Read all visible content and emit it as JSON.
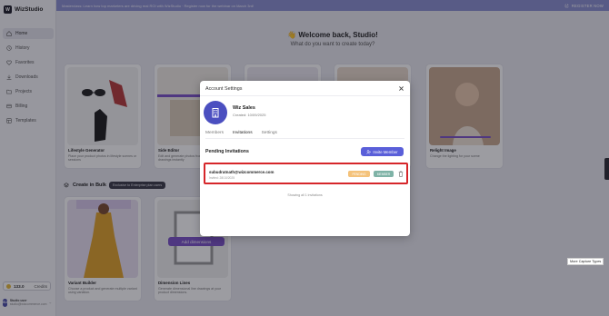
{
  "banner": {
    "text": "Masterclass: Learn how top marketers are driving real ROI with WizStudio · Register now for the webinar on March 3rd!",
    "cta": "REGISTER NOW"
  },
  "app": {
    "name": "WizStudio",
    "logo_letter": "W"
  },
  "sidebar": {
    "items": [
      {
        "label": "Home",
        "icon": "home-icon"
      },
      {
        "label": "History",
        "icon": "history-icon"
      },
      {
        "label": "Favorites",
        "icon": "heart-icon"
      },
      {
        "label": "Downloads",
        "icon": "download-icon"
      },
      {
        "label": "Projects",
        "icon": "folder-icon"
      },
      {
        "label": "Billing",
        "icon": "card-icon"
      },
      {
        "label": "Templates",
        "icon": "template-icon"
      }
    ],
    "credits": {
      "count": "133.0",
      "label": "Credits"
    },
    "user": {
      "initials": "SU",
      "name": "Studio user",
      "email": "studio@wizcommerce.com"
    }
  },
  "main": {
    "welcome": "👋 Welcome back, Studio!",
    "subtitle": "What do you want to create today?",
    "cards": [
      {
        "title": "Lifestyle Generator",
        "desc": "Place your product photos in lifestyle scenes or sessions"
      },
      {
        "title": "Side Editor",
        "desc": "Edit and generate photos from product drawings instantly"
      },
      {
        "title": "",
        "desc": ""
      },
      {
        "title": "",
        "desc": ""
      },
      {
        "title": "Relight Image",
        "desc": "Change the lighting for your scene"
      }
    ],
    "bulk": {
      "title": "Create in Bulk",
      "badge": "Exclusive to Enterprise plan users",
      "cards": [
        {
          "title": "Variant Builder",
          "desc": "Choose a product and generate multiple variant using variation."
        },
        {
          "title": "Dimension Lines",
          "desc": "Generate dimensional line drawings at your product dimensions."
        }
      ],
      "add_button": "Add dimensions"
    }
  },
  "capture_tip": "More Capture Types",
  "modal": {
    "title": "Account Settings",
    "org": {
      "name": "Wiz Sales",
      "created": "Created: 10/09/2025"
    },
    "tabs": [
      "Members",
      "Invitations",
      "Settings"
    ],
    "active_tab": "Invitations",
    "section_title": "Pending Invitations",
    "invite_button": "Invite Member",
    "invitations": [
      {
        "email": "subudratnath@wizcommerce.com",
        "date": "Invited: 28/10/2025",
        "status": "PENDING",
        "role": "MEMBER"
      }
    ],
    "showing": "Showing all 1 invitations"
  },
  "colors": {
    "accent": "#5a5fd9",
    "highlight": "#d6262a",
    "pending": "#f4c27a",
    "role": "#7fb3a7"
  }
}
